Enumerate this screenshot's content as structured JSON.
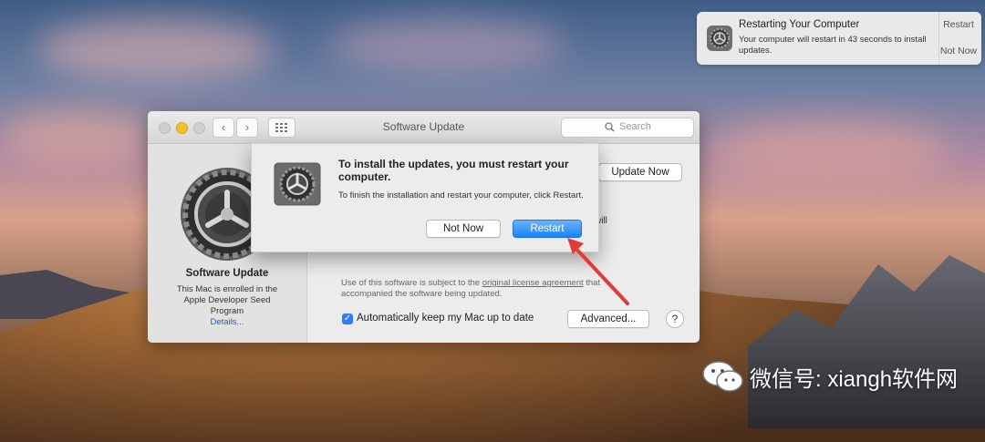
{
  "notification": {
    "title": "Restarting Your Computer",
    "body": "Your computer will restart in 43 seconds to install updates.",
    "restart_label": "Restart",
    "not_now_label": "Not Now"
  },
  "window": {
    "title": "Software Update",
    "search_placeholder": "Search",
    "sidebar": {
      "title": "Software Update",
      "text": "This Mac is enrolled in the Apple Developer Seed Program",
      "link": "Details..."
    },
    "update_now_label": "Update Now",
    "partial_text": "will",
    "license_prefix": "Use of this software is subject to the ",
    "license_link": "original license agreement",
    "license_suffix": " that accompanied the software being updated.",
    "auto_update_label": "Automatically keep my Mac up to date",
    "advanced_label": "Advanced...",
    "help_label": "?"
  },
  "sheet": {
    "title": "To install the updates, you must restart your computer.",
    "text": "To finish the installation and restart your computer, click Restart.",
    "not_now_label": "Not Now",
    "restart_label": "Restart"
  },
  "watermark": {
    "text": "微信号: xiangh软件网"
  },
  "colors": {
    "accent": "#1a82fb",
    "arrow": "#e43a36"
  }
}
